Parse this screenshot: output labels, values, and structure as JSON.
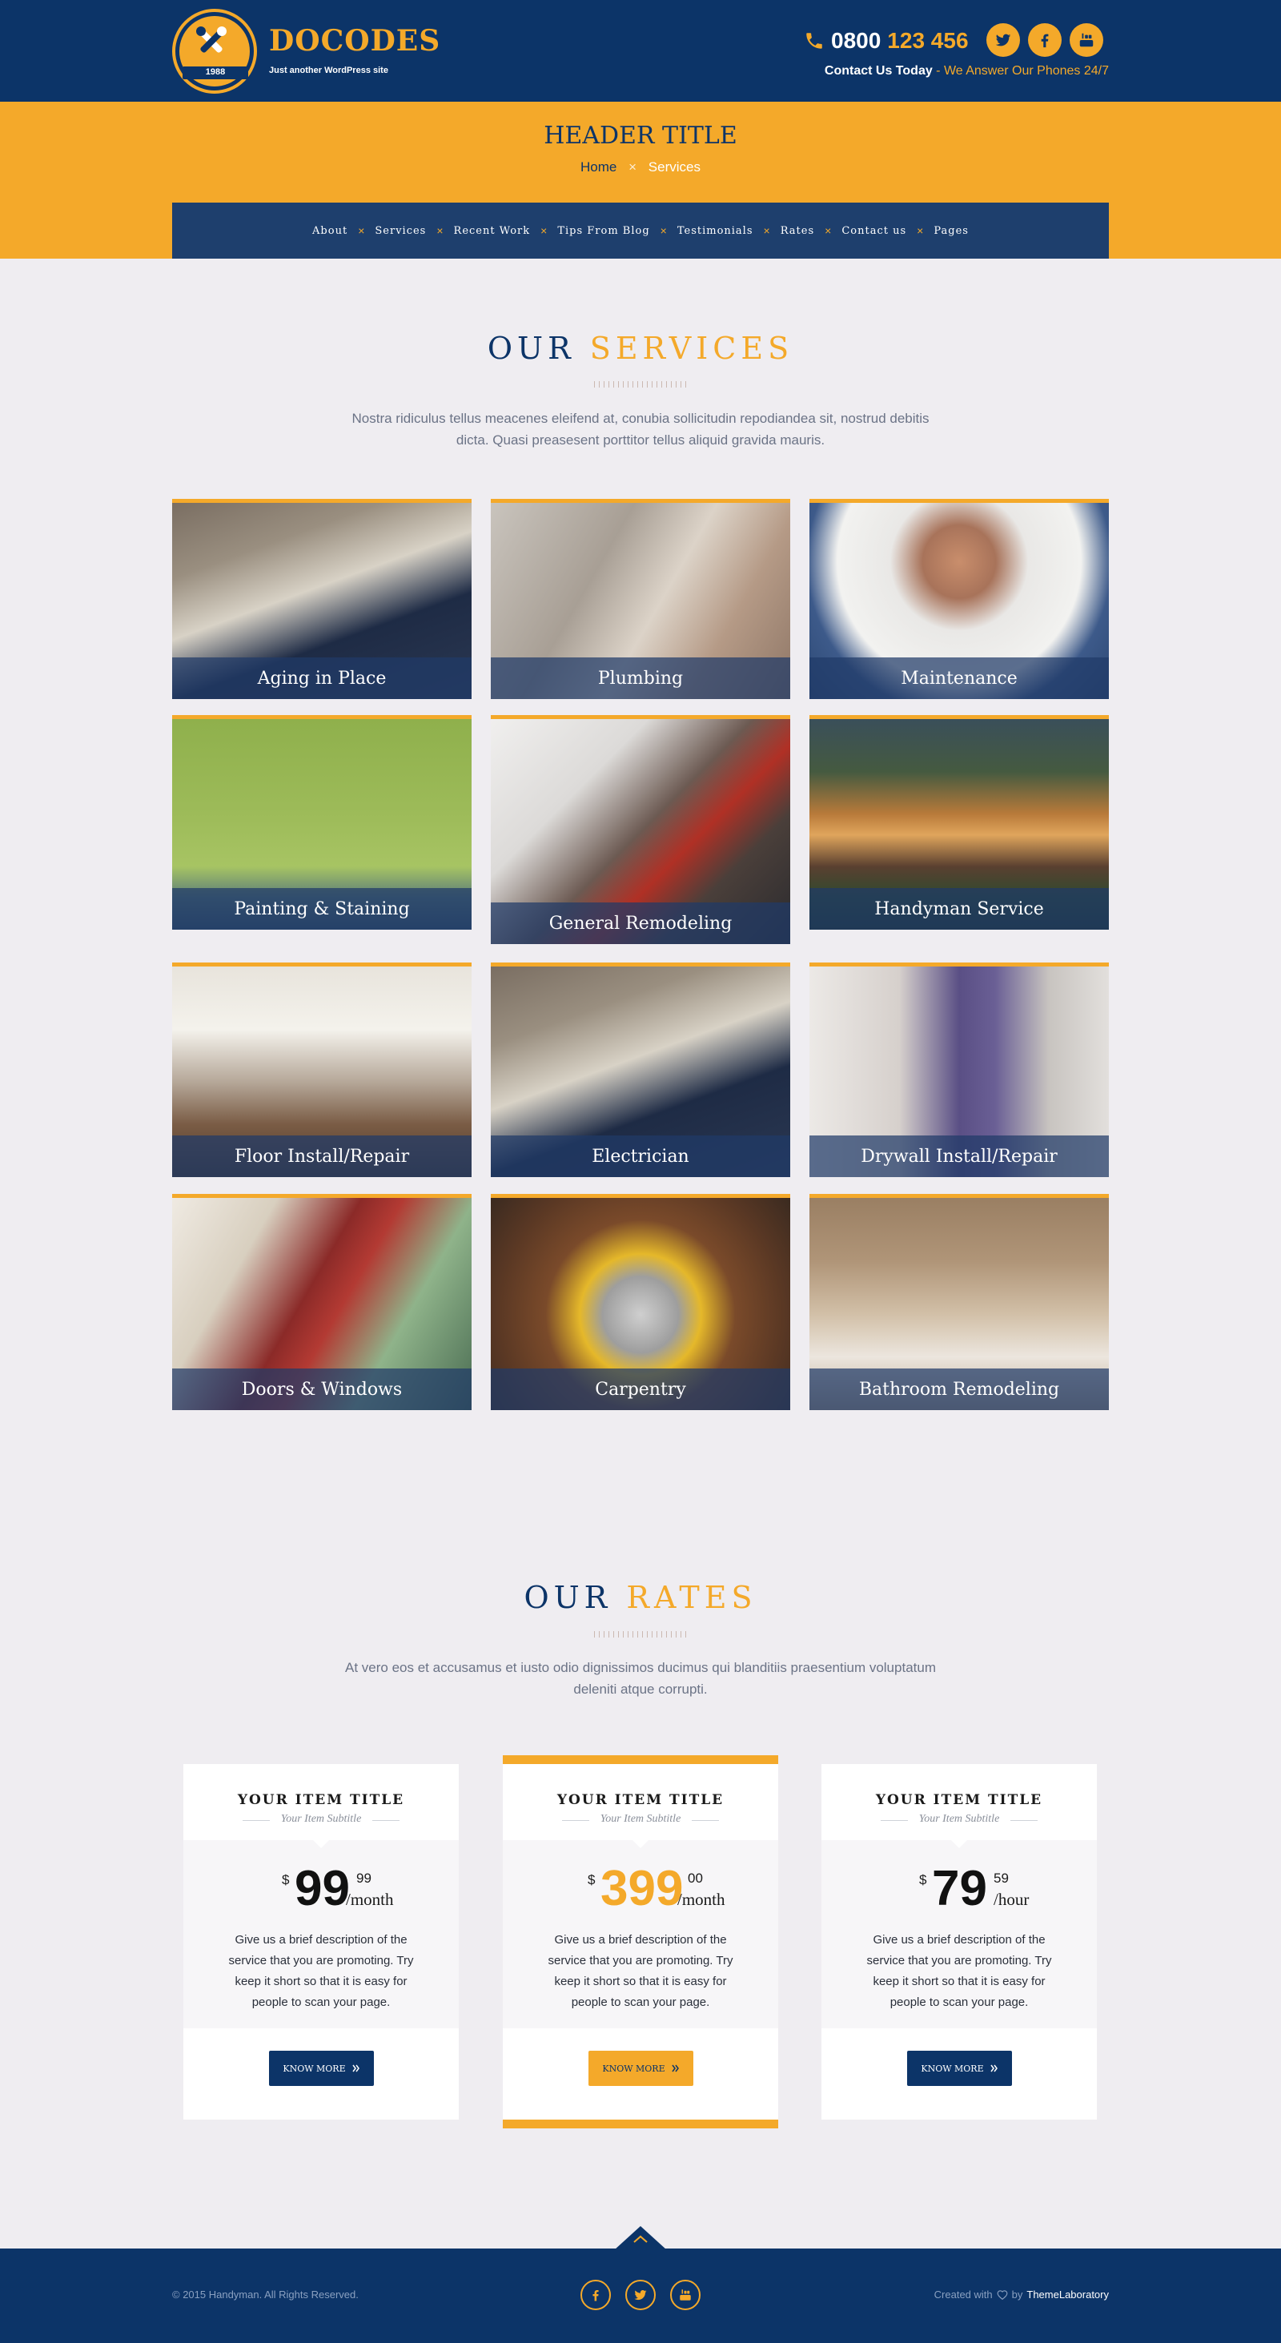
{
  "header": {
    "logo_year": "1988",
    "brand": "DOCODES",
    "tagline": "Just another WordPress site",
    "phone_prefix": "0800",
    "phone_number": "123 456",
    "contact_bold": "Contact Us Today",
    "contact_rest": " - We Answer Our Phones 24/7",
    "social_icons": [
      "twitter-icon",
      "facebook-icon",
      "youtube-icon"
    ]
  },
  "page": {
    "title": "HEADER TITLE",
    "breadcrumb": {
      "home": "Home",
      "separator": "×",
      "current": "Services"
    }
  },
  "nav": {
    "items": [
      "About",
      "Services",
      "Recent Work",
      "Tips From Blog",
      "Testimonials",
      "Rates",
      "Contact us",
      "Pages"
    ],
    "separator": "×"
  },
  "services": {
    "title_1": "OUR",
    "title_2": "SERVICES",
    "intro": "Nostra ridiculus tellus meacenes eleifend at, conubia sollicitudin repodiandea sit, nostrud debitis dicta. Quasi preasesent porttitor tellus aliquid gravida mauris.",
    "items": [
      "Aging in Place",
      "Plumbing",
      "Maintenance",
      "Painting & Staining",
      "General Remodeling",
      "Handyman Service",
      "Floor Install/Repair",
      "Electrician",
      "Drywall Install/Repair",
      "Doors & Windows",
      "Carpentry",
      "Bathroom Remodeling"
    ]
  },
  "rates": {
    "title_1": "OUR",
    "title_2": "RATES",
    "intro": "At vero eos et accusamus et iusto odio dignissimos ducimus qui blanditiis praesentium voluptatum deleniti atque corrupti.",
    "cards": [
      {
        "title": "YOUR ITEM TITLE",
        "subtitle": "Your Item Subtitle",
        "currency": "$",
        "amount": "99",
        "cents": "99",
        "period": "/month",
        "description": "Give us a brief description of the service that you are promoting. Try keep it short so that it is easy for people to scan your page.",
        "button": "KNOW MORE"
      },
      {
        "title": "YOUR ITEM TITLE",
        "subtitle": "Your Item Subtitle",
        "currency": "$",
        "amount": "399",
        "cents": "00",
        "period": "/month",
        "description": "Give us a brief description of the service that you are promoting. Try keep it short so that it is easy for people to scan your page.",
        "button": "KNOW MORE"
      },
      {
        "title": "YOUR ITEM TITLE",
        "subtitle": "Your Item Subtitle",
        "currency": "$",
        "amount": "79",
        "cents": "59",
        "period": "/hour",
        "description": "Give us a brief description of the service that you are promoting. Try keep it short so that it is easy for people to scan your page.",
        "button": "KNOW MORE"
      }
    ]
  },
  "footer": {
    "copyright": "© 2015 Handyman. All Rights Reserved.",
    "credits_prefix": "Created with",
    "credits_by": "by",
    "credits_link": "ThemeLaboratory",
    "social_icons": [
      "facebook-icon",
      "twitter-icon",
      "youtube-icon"
    ]
  },
  "colors": {
    "navy": "#0c3468",
    "gold": "#f4a92a",
    "background": "#efedf1"
  }
}
